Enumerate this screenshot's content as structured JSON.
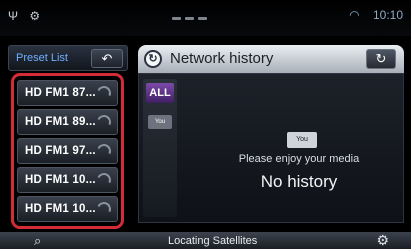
{
  "status_bar": {
    "left_icons": "Ψ ⚙",
    "time": "10:10",
    "wifi": "◠"
  },
  "preset_panel": {
    "title": "Preset List",
    "back_glyph": "↶",
    "items": [
      {
        "label": "HD FM1 87..."
      },
      {
        "label": "HD FM1 89..."
      },
      {
        "label": "HD FM1 97..."
      },
      {
        "label": "HD FM1 10..."
      },
      {
        "label": "HD FM1 10..."
      }
    ]
  },
  "network_panel": {
    "title": "Network history",
    "icon_glyph": "↻",
    "refresh_glyph": "↻",
    "filters": {
      "all_label": "ALL",
      "yt_label": "You"
    },
    "media_icon_label": "You",
    "message": "Please enjoy your media",
    "empty_state": "No history"
  },
  "bottom_bar": {
    "left_glyph": "⌕",
    "status": "Locating Satellites",
    "right_glyph": "⚙"
  }
}
